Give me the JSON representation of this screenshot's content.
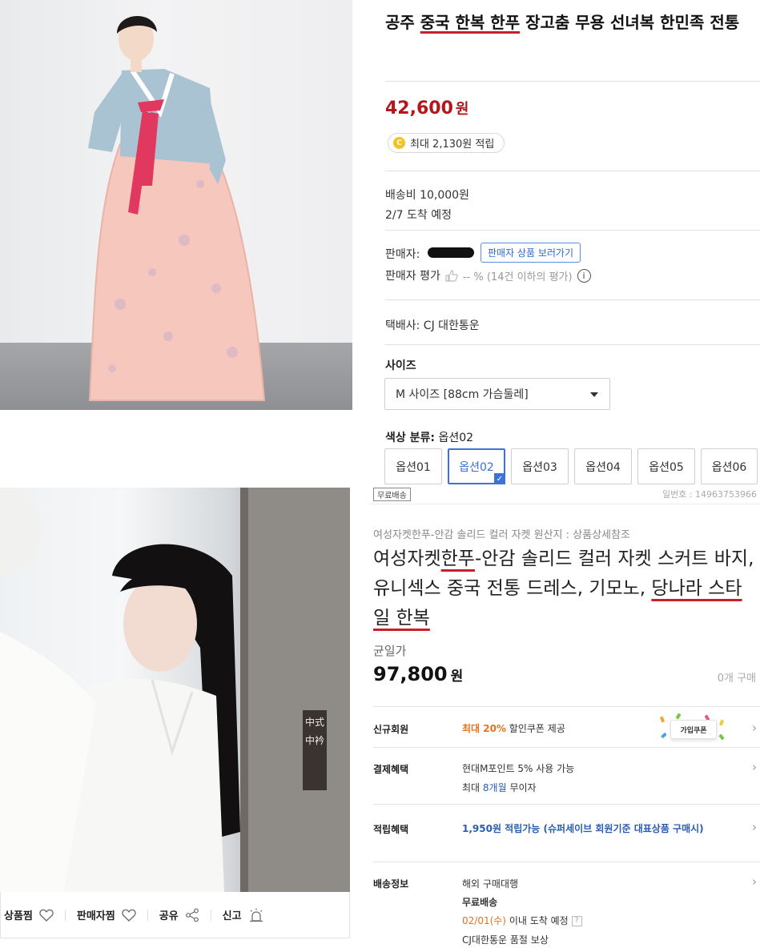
{
  "product1": {
    "title_plain": "공주",
    "title_underlined": "중국 한복 한푸",
    "title_rest": "장고춤 무용 선녀복 한민족 전통",
    "price": "42,600",
    "currency": "원",
    "point_icon": "C",
    "point_text": "최대 2,130원 적립",
    "shipping_fee": "배송비 10,000원",
    "arrival": "2/7 도착 예정",
    "seller_label": "판매자:",
    "seller_button": "판매자 상품 보러가기",
    "seller_rating_label": "판매자 평가",
    "seller_rating_value": "-- % (14건 이하의 평가)",
    "info_icon": "i",
    "courier": "택배사: CJ 대한통운",
    "size_label": "사이즈",
    "size_selected": "M 사이즈 [88cm 가슴둘레]",
    "color_label_bold": "색상 분류:",
    "color_label_value": "옵션02",
    "options": [
      "옵션01",
      "옵션02",
      "옵션03",
      "옵션04",
      "옵션05",
      "옵션06"
    ],
    "selected_option_index": 1
  },
  "product2": {
    "free_badge": "무료배송",
    "product_no": "일번호 : 14963753966",
    "crumbs": "여성자켓한푸-안감 솔리드 컬러 자켓     원산지 : 상품상세참조",
    "title_a": "여성자켓",
    "title_b": "한푸",
    "title_c": "-안감 솔리드 컬러 자켓 스커트 바지, 유니섹스 중국 전통 드레스, 기모노, ",
    "title_d": "당나라 스타일 한복",
    "unit_price_label": "균일가",
    "price": "97,800",
    "currency": "원",
    "sold": "0개 구매",
    "rows": {
      "new_member_label": "신규회원",
      "new_member_highlight": "최대 20%",
      "new_member_text": " 할인쿠폰 제공",
      "coupon_tag": "가입쿠폰",
      "payment_label": "결제혜택",
      "payment_line1": "현대M포인트 5% 사용 가능",
      "payment_line2_a": "최대 ",
      "payment_line2_b": "8개월",
      "payment_line2_c": " 무이자",
      "reward_label": "적립혜택",
      "reward_text": "1,950원 적립가능 (슈퍼세이브 회원기준 대표상품 구매시)",
      "delivery_label": "배송정보",
      "delivery_line1": "해외 구매대행",
      "delivery_line2": "무료배송",
      "delivery_date": "02/01(수)",
      "delivery_line3_rest": " 이내 도착 예정",
      "delivery_q": "?",
      "delivery_line4": "CJ대한통운  품절 보상"
    }
  },
  "photo2_stamp": "中式中衿",
  "actions": {
    "wish": "상품찜",
    "seller_wish": "판매자찜",
    "share": "공유",
    "report": "신고"
  }
}
